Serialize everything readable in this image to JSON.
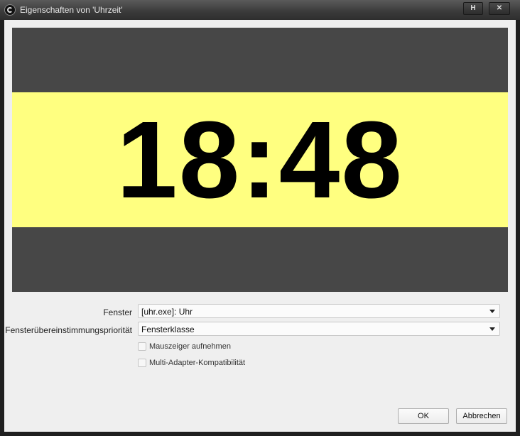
{
  "window": {
    "title": "Eigenschaften von 'Uhrzeit'",
    "buttons": {
      "help_label": "H",
      "close_label": "✕"
    }
  },
  "preview": {
    "clock_text": "18:48",
    "colors": {
      "background": "#474747",
      "band": "#ffff80",
      "text": "#000000"
    }
  },
  "form": {
    "window_label": "Fenster",
    "window_value": "[uhr.exe]: Uhr",
    "priority_label": "Fensterübereinstimmungspriorität",
    "priority_value": "Fensterklasse",
    "capture_cursor_label": "Mauszeiger aufnehmen",
    "capture_cursor_checked": false,
    "multi_adapter_label": "Multi-Adapter-Kompatibilität",
    "multi_adapter_checked": false
  },
  "footer": {
    "ok_label": "OK",
    "cancel_label": "Abbrechen"
  }
}
